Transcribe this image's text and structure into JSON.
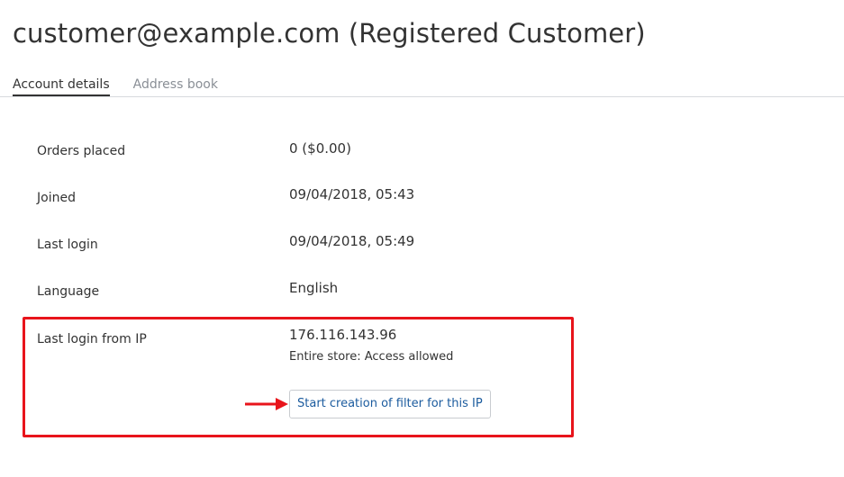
{
  "header": {
    "title": "customer@example.com (Registered Customer)"
  },
  "tabs": [
    {
      "label": "Account details",
      "active": true
    },
    {
      "label": "Address book",
      "active": false
    }
  ],
  "details": {
    "orders_placed": {
      "label": "Orders placed",
      "value": "0  ($0.00)"
    },
    "joined": {
      "label": "Joined",
      "value": "09/04/2018, 05:43"
    },
    "last_login": {
      "label": "Last login",
      "value": "09/04/2018, 05:49"
    },
    "language": {
      "label": "Language",
      "value": "English"
    },
    "last_login_ip": {
      "label": "Last login from IP",
      "value": "176.116.143.96",
      "access_status": "Entire store: Access allowed",
      "filter_button_label": "Start creation of filter for this IP"
    }
  },
  "colors": {
    "highlight": "#e8141b",
    "link": "#1b5b9e",
    "text": "#333333",
    "muted": "#8a8f96"
  },
  "icons": {
    "annotation_arrow": "arrow-right-icon"
  }
}
